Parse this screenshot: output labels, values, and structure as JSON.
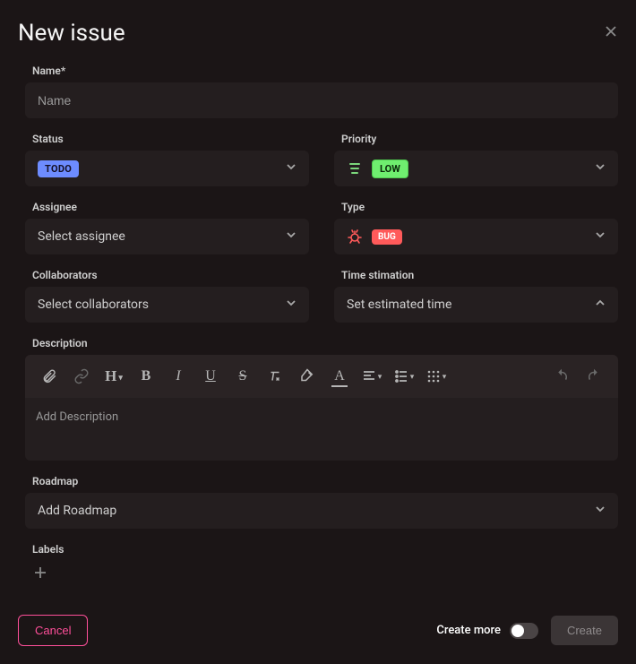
{
  "header": {
    "title": "New issue"
  },
  "fields": {
    "name": {
      "label": "Name*",
      "placeholder": "Name"
    },
    "status": {
      "label": "Status",
      "badge": "TODO"
    },
    "priority": {
      "label": "Priority",
      "badge": "LOW"
    },
    "assignee": {
      "label": "Assignee",
      "placeholder": "Select assignee"
    },
    "type": {
      "label": "Type",
      "badge": "BUG"
    },
    "collaborators": {
      "label": "Collaborators",
      "placeholder": "Select collaborators"
    },
    "time": {
      "label": "Time stimation",
      "placeholder": "Set estimated time"
    },
    "description": {
      "label": "Description",
      "placeholder": "Add Description"
    },
    "roadmap": {
      "label": "Roadmap",
      "placeholder": "Add Roadmap"
    },
    "labels": {
      "label": "Labels"
    }
  },
  "footer": {
    "cancel": "Cancel",
    "create_more": "Create more",
    "create": "Create"
  }
}
